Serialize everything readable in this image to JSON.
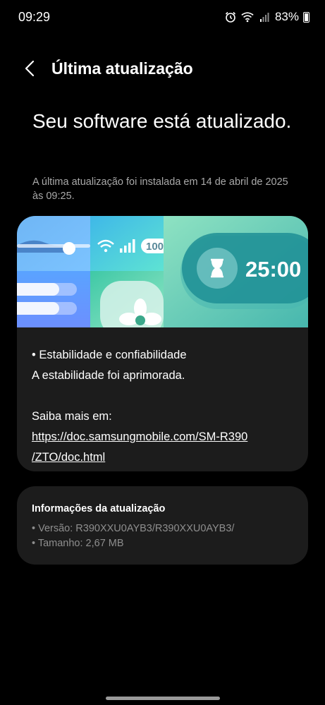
{
  "status_bar": {
    "time": "09:29",
    "battery": "83%",
    "icons": [
      "alarm-icon",
      "wifi-icon",
      "signal-icon",
      "battery-icon"
    ]
  },
  "header": {
    "back_icon": "chevron-left-icon",
    "title": "Última atualização"
  },
  "headline": "Seu software está atualizado.",
  "install_note": "A última atualização foi instalada em 14 de abril de 2025 às 09:25.",
  "banner": {
    "badge": "100",
    "timer": "25:00",
    "icons": [
      "wifi-icon",
      "signal-icon",
      "hourglass-icon",
      "fan-icon"
    ]
  },
  "details": {
    "bullet": "• Estabilidade e confiabilidade",
    "description": "A estabilidade foi aprimorada.",
    "learn_more": "Saiba mais em:",
    "link_line1": "https://doc.samsungmobile.com/SM-R390",
    "link_line2": "/ZTO/doc.html"
  },
  "update_info": {
    "title": "Informações da atualização",
    "version": "• Versão: R390XXU0AYB3/R390XXU0AYB3/",
    "size": "• Tamanho: 2,67 MB"
  },
  "colors": {
    "background": "#000000",
    "card": "#1c1c1c",
    "secondary_text": "#a9a9a9"
  }
}
